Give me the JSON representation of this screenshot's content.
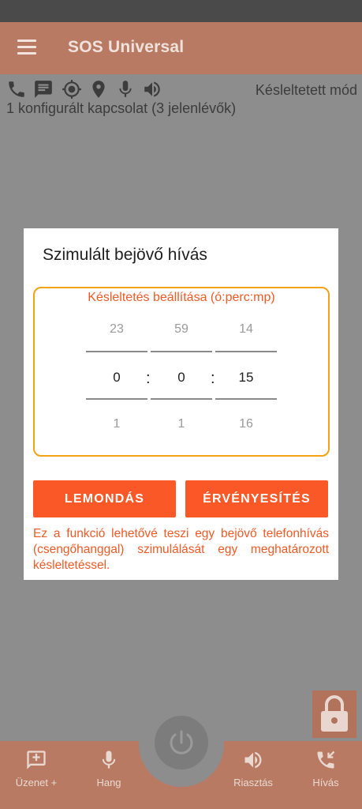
{
  "app": {
    "title": "SOS Universal"
  },
  "status": {
    "mode": "Késleltetett mód",
    "config": "1 konfigurált kapcsolat (3 jelenlévők)"
  },
  "dialog": {
    "title": "Szimulált bejövő hívás",
    "picker_label": "Késleltetés beállítása (ó:perc:mp)",
    "separator": ":",
    "columns": [
      {
        "prev": "23",
        "value": "0",
        "next": "1"
      },
      {
        "prev": "59",
        "value": "0",
        "next": "1"
      },
      {
        "prev": "14",
        "value": "15",
        "next": "16"
      }
    ],
    "cancel_label": "LEMONDÁS",
    "confirm_label": "ÉRVÉNYESÍTÉS",
    "description": "Ez a funkció lehetővé teszi egy bejövő telefonhívás (csengőhanggal) szimulálását egy meghatározott késleltetéssel."
  },
  "bottom_nav": {
    "message_label": "Üzenet +",
    "voice_label": "Hang",
    "alarm_label": "Riasztás",
    "call_label": "Hívás"
  },
  "colors": {
    "accent": "#fa5826",
    "picker_border": "#f2a314",
    "app_bar": "#b97a64"
  }
}
